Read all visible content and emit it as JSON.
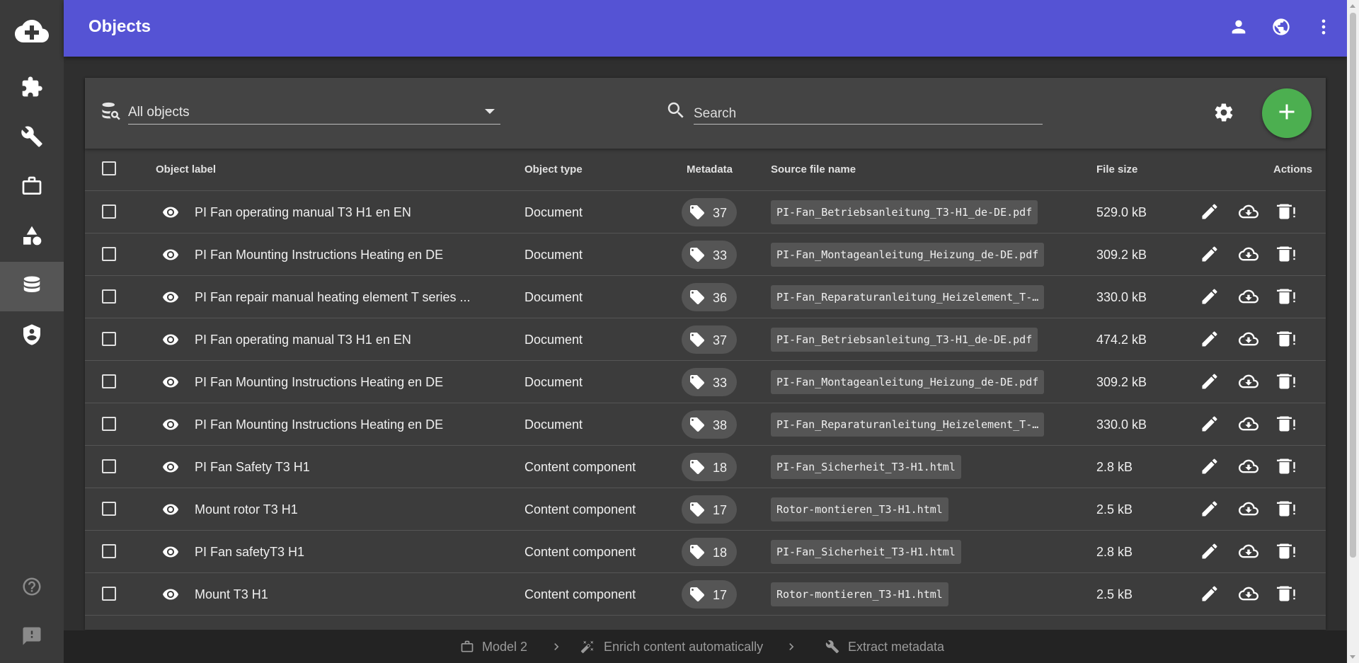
{
  "header": {
    "title": "Objects",
    "icons": [
      "account-icon",
      "globe-icon",
      "more-vert-icon"
    ]
  },
  "sidebar": {
    "items": [
      {
        "icon": "cloud-add-icon"
      },
      {
        "icon": "puzzle-icon"
      },
      {
        "icon": "wrench-icon"
      },
      {
        "icon": "briefcase-icon"
      },
      {
        "icon": "shapes-icon"
      },
      {
        "icon": "database-icon",
        "active": true
      },
      {
        "icon": "shield-user-icon"
      },
      {
        "icon": "help-icon"
      },
      {
        "icon": "feedback-icon"
      }
    ]
  },
  "toolbar": {
    "filter_value": "All objects",
    "search_placeholder": "Search"
  },
  "table": {
    "headers": {
      "label": "Object label",
      "type": "Object type",
      "metadata": "Metadata",
      "source": "Source file name",
      "size": "File size",
      "actions": "Actions"
    },
    "rows": [
      {
        "label": "PI Fan operating manual T3 H1 en EN",
        "type": "Document",
        "metadata": "37",
        "source": "PI-Fan_Betriebsanleitung_T3-H1_de-DE.pdf",
        "size": "529.0 kB"
      },
      {
        "label": "PI Fan Mounting Instructions Heating en DE",
        "type": "Document",
        "metadata": "33",
        "source": "PI-Fan_Montageanleitung_Heizung_de-DE.pdf",
        "size": "309.2 kB"
      },
      {
        "label": "PI Fan repair manual heating element T series ...",
        "type": "Document",
        "metadata": "36",
        "source": "PI-Fan_Reparaturanleitung_Heizelement_T-…",
        "size": "330.0 kB"
      },
      {
        "label": "PI Fan operating manual T3 H1 en EN",
        "type": "Document",
        "metadata": "37",
        "source": "PI-Fan_Betriebsanleitung_T3-H1_de-DE.pdf",
        "size": "474.2 kB"
      },
      {
        "label": "PI Fan Mounting Instructions Heating en DE",
        "type": "Document",
        "metadata": "33",
        "source": "PI-Fan_Montageanleitung_Heizung_de-DE.pdf",
        "size": "309.2 kB"
      },
      {
        "label": "PI Fan Mounting Instructions Heating en DE",
        "type": "Document",
        "metadata": "38",
        "source": "PI-Fan_Reparaturanleitung_Heizelement_T-…",
        "size": "330.0 kB"
      },
      {
        "label": "PI Fan Safety T3 H1",
        "type": "Content component",
        "metadata": "18",
        "source": "PI-Fan_Sicherheit_T3-H1.html",
        "size": "2.8 kB"
      },
      {
        "label": "Mount rotor T3 H1",
        "type": "Content component",
        "metadata": "17",
        "source": "Rotor-montieren_T3-H1.html",
        "size": "2.5 kB"
      },
      {
        "label": "PI Fan safetyT3 H1",
        "type": "Content component",
        "metadata": "18",
        "source": "PI-Fan_Sicherheit_T3-H1.html",
        "size": "2.8 kB"
      },
      {
        "label": "Mount T3 H1",
        "type": "Content component",
        "metadata": "17",
        "source": "Rotor-montieren_T3-H1.html",
        "size": "2.5 kB"
      }
    ]
  },
  "footer": {
    "breadcrumb": [
      {
        "icon": "briefcase-icon",
        "label": "Model 2"
      },
      {
        "icon": "magic-wand-icon",
        "label": "Enrich content automatically"
      },
      {
        "icon": "wrench-icon",
        "label": "Extract metadata"
      }
    ]
  },
  "colors": {
    "header": "#5553d4",
    "sidebar": "#3a3a3a",
    "panel": "#3c3c3c",
    "fab": "#4caf50"
  }
}
